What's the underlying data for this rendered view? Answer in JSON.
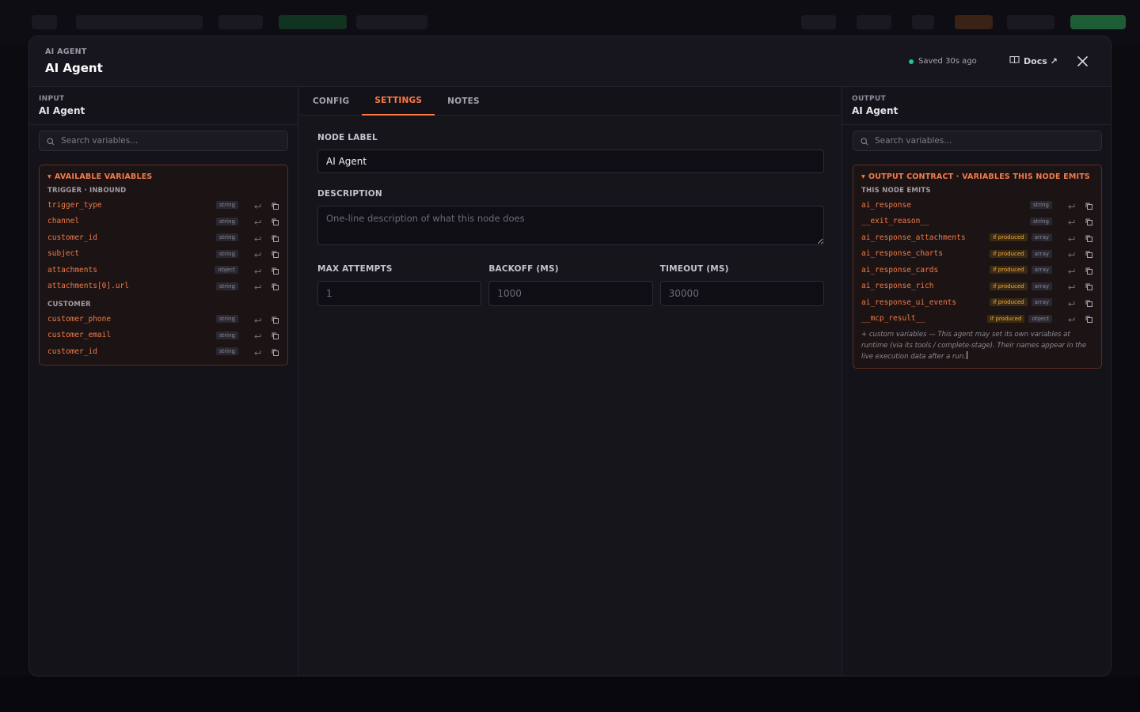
{
  "modal": {
    "kicker": "AI AGENT",
    "title": "AI Agent",
    "saved_status": "Saved 30s ago",
    "docs_label": "Docs ↗"
  },
  "input_panel": {
    "kicker": "INPUT",
    "name": "AI Agent",
    "search_placeholder": "Search variables...",
    "box_title": "AVAILABLE VARIABLES",
    "groups": [
      {
        "label": "TRIGGER · INBOUND",
        "vars": [
          {
            "name": "trigger_type",
            "type": "string"
          },
          {
            "name": "channel",
            "type": "string"
          },
          {
            "name": "customer_id",
            "type": "string"
          },
          {
            "name": "subject",
            "type": "string"
          },
          {
            "name": "attachments",
            "type": "object"
          },
          {
            "name": "attachments[0].url",
            "type": "string"
          }
        ]
      },
      {
        "label": "CUSTOMER",
        "vars": [
          {
            "name": "customer_phone",
            "type": "string"
          },
          {
            "name": "customer_email",
            "type": "string"
          },
          {
            "name": "customer_id",
            "type": "string"
          }
        ]
      }
    ]
  },
  "tabs": [
    {
      "label": "CONFIG"
    },
    {
      "label": "SETTINGS"
    },
    {
      "label": "NOTES"
    }
  ],
  "settings": {
    "node_label": "NODE LABEL",
    "node_value": "AI Agent",
    "description_label": "DESCRIPTION",
    "description_placeholder": "One-line description of what this node does",
    "max_attempts_label": "MAX ATTEMPTS",
    "max_attempts_placeholder": "1",
    "backoff_label": "BACKOFF (MS)",
    "backoff_placeholder": "1000",
    "timeout_label": "TIMEOUT (MS)",
    "timeout_placeholder": "30000"
  },
  "output_panel": {
    "kicker": "OUTPUT",
    "name": "AI Agent",
    "search_placeholder": "Search variables...",
    "box_title": "OUTPUT CONTRACT · VARIABLES THIS NODE EMITS",
    "group_label": "THIS NODE EMITS",
    "produced_label": "if produced",
    "vars": [
      {
        "name": "ai_response",
        "type": "string",
        "produced": false
      },
      {
        "name": "__exit_reason__",
        "type": "string",
        "produced": false
      },
      {
        "name": "ai_response_attachments",
        "type": "array",
        "produced": true
      },
      {
        "name": "ai_response_charts",
        "type": "array",
        "produced": true
      },
      {
        "name": "ai_response_cards",
        "type": "array",
        "produced": true
      },
      {
        "name": "ai_response_rich",
        "type": "array",
        "produced": true
      },
      {
        "name": "ai_response_ui_events",
        "type": "array",
        "produced": true
      },
      {
        "name": "__mcp_result__",
        "type": "object",
        "produced": true
      }
    ],
    "note": "+ custom variables — This agent may set its own variables at runtime (via its tools / complete-stage). Their names appear in the live execution data after a run."
  },
  "colors": {
    "accent": "#ff7a45",
    "saved_dot": "#23c19a",
    "produced_tag": "#f0a93e"
  }
}
